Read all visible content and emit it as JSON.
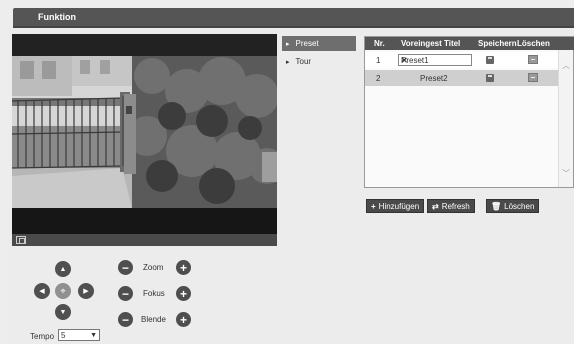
{
  "header": {
    "tab_label": "Funktion"
  },
  "menu": {
    "items": [
      {
        "label": "Preset",
        "active": true
      },
      {
        "label": "Tour",
        "active": false
      }
    ]
  },
  "preset_table": {
    "columns": [
      "Nr.",
      "Voreingest Titel",
      "Speichern",
      "Löschen"
    ],
    "rows": [
      {
        "nr": "1",
        "title": "Preset1",
        "editing": true
      },
      {
        "nr": "2",
        "title": "Preset2",
        "editing": false
      }
    ]
  },
  "actions": {
    "add_label": "Hinzufügen",
    "refresh_label": "Refresh",
    "delete_label": "Löschen"
  },
  "ptz": {
    "zoom_label": "Zoom",
    "focus_label": "Fokus",
    "iris_label": "Blende",
    "tempo_label": "Tempo",
    "tempo_value": "5",
    "minus_symbol": "−",
    "plus_symbol": "+"
  },
  "colors": {
    "header_bar": "#555555",
    "active_menu": "#6e6e6e",
    "selected_row": "#cfcfcf",
    "button_dark": "#4a4a4a"
  }
}
